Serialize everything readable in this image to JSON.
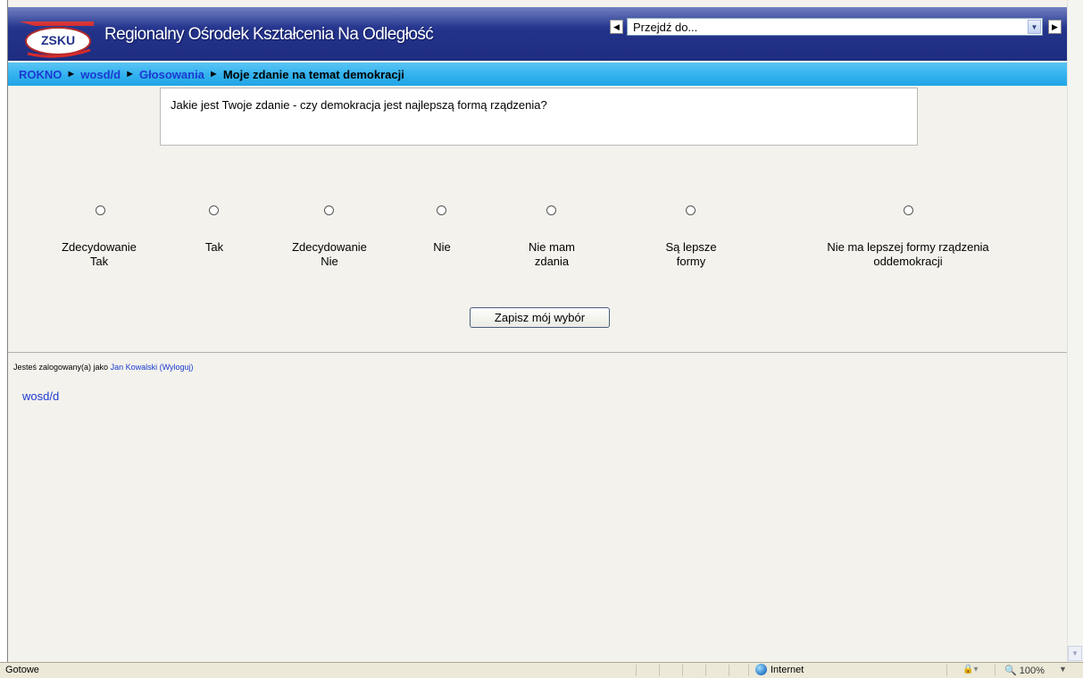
{
  "header": {
    "logo_text": "ZSKU",
    "site_title": "Regionalny Ośrodek Kształcenia Na Odległość",
    "jump_placeholder": "Przejdź do..."
  },
  "breadcrumb": {
    "items": [
      "ROKNO",
      "wosd/d",
      "Głosowania"
    ],
    "current": "Moje zdanie na temat demokracji",
    "separator": "►"
  },
  "question": "Jakie jest Twoje zdanie - czy demokracja jest najlepszą formą rządzenia?",
  "choices": [
    {
      "line1": "Zdecydowanie",
      "line2": "Tak"
    },
    {
      "line1": "Tak",
      "line2": ""
    },
    {
      "line1": "Zdecydowanie",
      "line2": "Nie"
    },
    {
      "line1": "Nie",
      "line2": ""
    },
    {
      "line1": "Nie mam",
      "line2": "zdania"
    },
    {
      "line1": "Są lepsze",
      "line2": "formy"
    },
    {
      "line1": "Nie ma lepszej formy rządzenia",
      "line2": "oddemokracji"
    }
  ],
  "save_label": "Zapisz mój wybór",
  "login": {
    "prefix": "Jesteś zalogowany(a) jako",
    "user": "Jan Kowalski",
    "logout": "(Wyloguj)"
  },
  "footer_course": "wosd/d",
  "statusbar": {
    "status": "Gotowe",
    "zone": "Internet",
    "zoom": "100%"
  },
  "colors": {
    "banner": "#23338a",
    "breadcrumb_bar": "#2fb0ee",
    "link": "#1c3ad1",
    "page_bg": "#f3f2ec"
  }
}
